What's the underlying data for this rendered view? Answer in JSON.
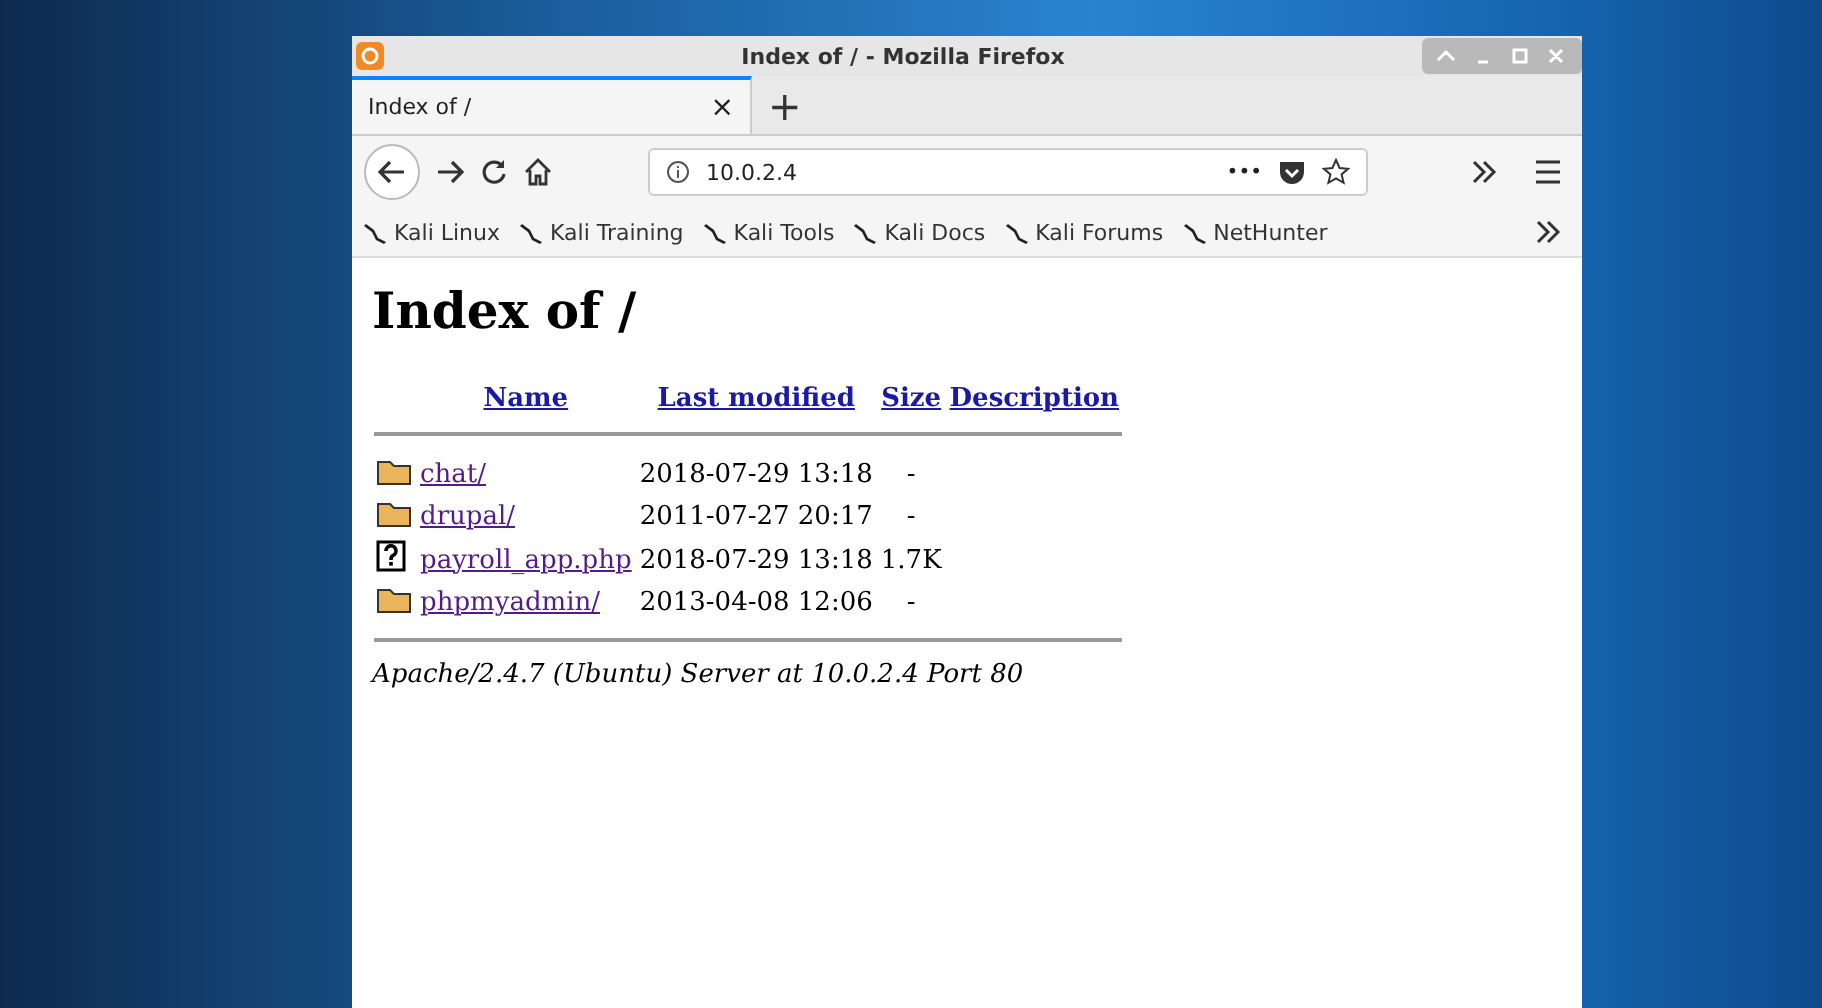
{
  "window": {
    "title": "Index of / - Mozilla Firefox"
  },
  "tabs": [
    {
      "label": "Index of /",
      "selected": true,
      "close": "×"
    }
  ],
  "new_tab": "+",
  "address_bar": {
    "url": "10.0.2.4",
    "menu": "•••"
  },
  "bookmarks": [
    {
      "label": "Kali Linux"
    },
    {
      "label": "Kali Training"
    },
    {
      "label": "Kali Tools"
    },
    {
      "label": "Kali Docs"
    },
    {
      "label": "Kali Forums"
    },
    {
      "label": "NetHunter"
    }
  ],
  "page": {
    "heading": "Index of /",
    "columns": [
      "Name",
      "Last modified",
      "Size",
      "Description"
    ],
    "rows": [
      {
        "kind": "folder",
        "name": "chat/",
        "modified": "2018-07-29 13:18",
        "size": "-"
      },
      {
        "kind": "folder",
        "name": "drupal/",
        "modified": "2011-07-27 20:17",
        "size": "-"
      },
      {
        "kind": "file",
        "name": "payroll_app.php",
        "modified": "2018-07-29 13:18",
        "size": "1.7K"
      },
      {
        "kind": "folder",
        "name": "phpmyadmin/",
        "modified": "2013-04-08 12:06",
        "size": "-"
      }
    ],
    "footer": "Apache/2.4.7 (Ubuntu) Server at 10.0.2.4 Port 80"
  }
}
